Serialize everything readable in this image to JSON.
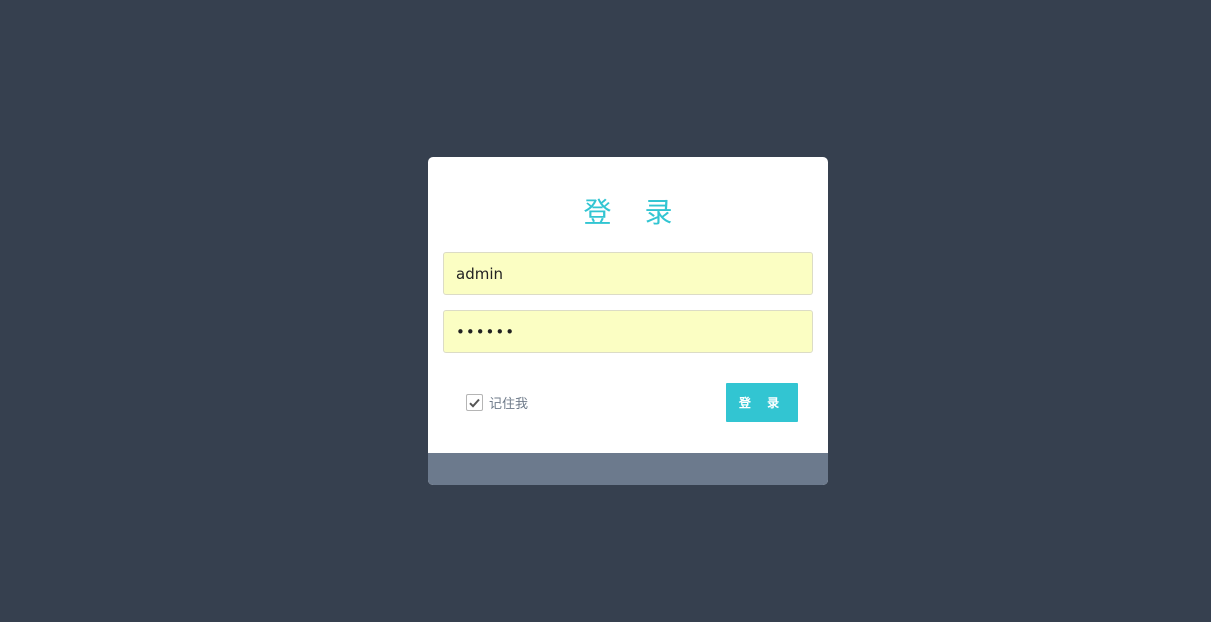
{
  "theme": {
    "background": "#36404f",
    "accent": "#32c5d2",
    "input_fill": "#fbfec3",
    "footer": "#6c7a8d"
  },
  "login": {
    "title": "登 录",
    "username": {
      "value": "admin"
    },
    "password": {
      "value": "••••••"
    },
    "remember": {
      "label": "记住我",
      "checked": true,
      "icon": "check-icon"
    },
    "submit_label": "登 录"
  }
}
